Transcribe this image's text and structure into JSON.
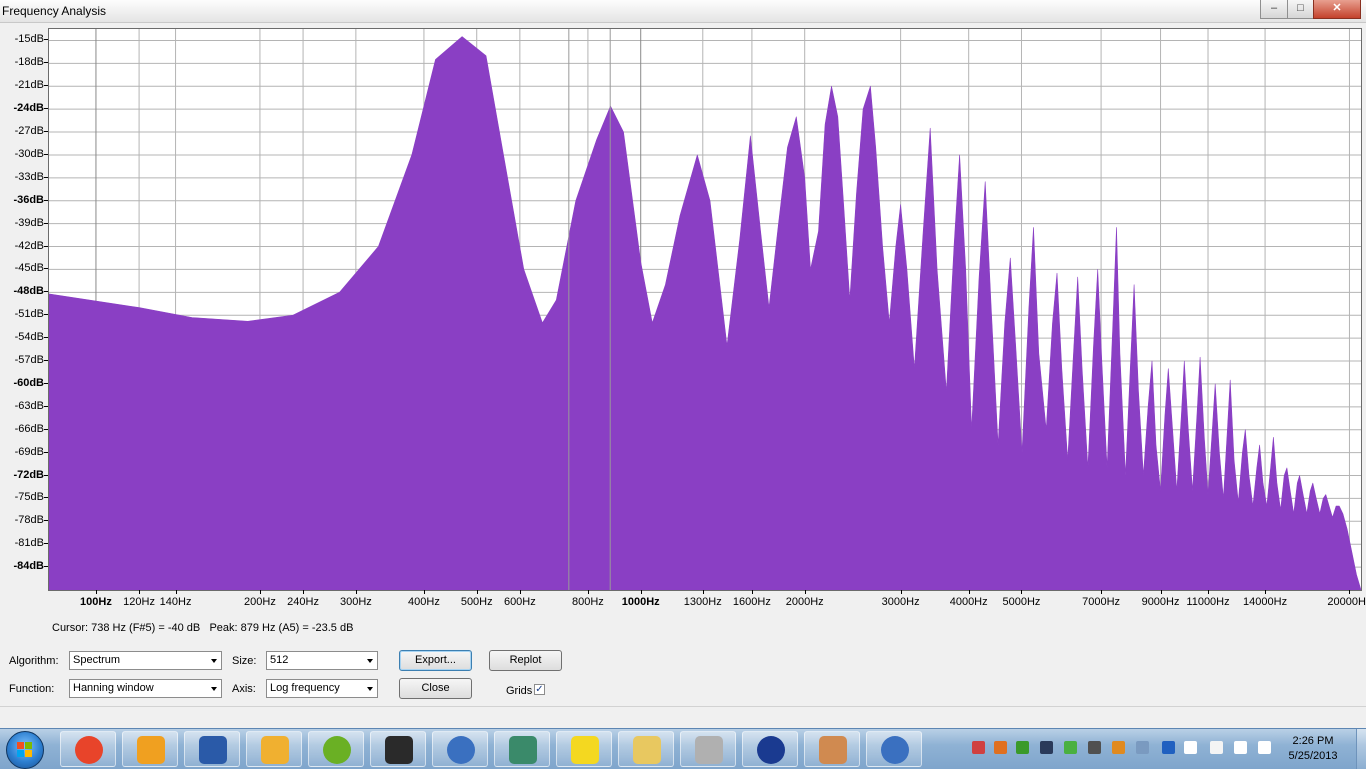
{
  "window": {
    "title": "Frequency Analysis",
    "buttons": {
      "minimize": "–",
      "maximize": "□",
      "close": "✕"
    }
  },
  "chart_data": {
    "type": "area",
    "title": "",
    "xlabel": "",
    "ylabel": "",
    "x_scale": "log",
    "xlim": [
      82,
      21000
    ],
    "ylim": [
      -87,
      -13.5
    ],
    "grid": true,
    "fill_color": "#8a3fc4",
    "y_ticks": [
      "-15dB",
      "-18dB",
      "-21dB",
      "-24dB",
      "-27dB",
      "-30dB",
      "-33dB",
      "-36dB",
      "-39dB",
      "-42dB",
      "-45dB",
      "-48dB",
      "-51dB",
      "-54dB",
      "-57dB",
      "-60dB",
      "-63dB",
      "-66dB",
      "-69dB",
      "-72dB",
      "-75dB",
      "-78dB",
      "-81dB",
      "-84dB"
    ],
    "y_tick_values": [
      -15,
      -18,
      -21,
      -24,
      -27,
      -30,
      -33,
      -36,
      -39,
      -42,
      -45,
      -48,
      -51,
      -54,
      -57,
      -60,
      -63,
      -66,
      -69,
      -72,
      -75,
      -78,
      -81,
      -84
    ],
    "y_tick_bold": [
      -24,
      -36,
      -48,
      -60,
      -72,
      -84
    ],
    "x_ticks": [
      "100Hz",
      "120Hz",
      "140Hz",
      "200Hz",
      "240Hz",
      "300Hz",
      "400Hz",
      "500Hz",
      "600Hz",
      "800Hz",
      "1000Hz",
      "1300Hz",
      "1600Hz",
      "2000Hz",
      "3000Hz",
      "4000Hz",
      "5000Hz",
      "7000Hz",
      "9000Hz",
      "11000Hz",
      "14000Hz",
      "20000Hz"
    ],
    "x_tick_values": [
      100,
      120,
      140,
      200,
      240,
      300,
      400,
      500,
      600,
      800,
      1000,
      1300,
      1600,
      2000,
      3000,
      4000,
      5000,
      7000,
      9000,
      11000,
      14000,
      20000
    ],
    "x_tick_bold": [
      100,
      1000
    ],
    "envelope": [
      [
        82,
        -48.2
      ],
      [
        120,
        -50
      ],
      [
        150,
        -51.3
      ],
      [
        190,
        -51.8
      ],
      [
        230,
        -51
      ],
      [
        280,
        -48
      ],
      [
        330,
        -42
      ],
      [
        380,
        -30
      ],
      [
        420,
        -17.5
      ],
      [
        470,
        -14.5
      ],
      [
        520,
        -17
      ],
      [
        560,
        -30
      ],
      [
        610,
        -45
      ],
      [
        660,
        -52
      ],
      [
        700,
        -49
      ],
      [
        760,
        -36
      ],
      [
        830,
        -28
      ],
      [
        880,
        -23.6
      ],
      [
        930,
        -27
      ],
      [
        1000,
        -44
      ],
      [
        1050,
        -52
      ],
      [
        1110,
        -47
      ],
      [
        1180,
        -38
      ],
      [
        1270,
        -30
      ],
      [
        1340,
        -36
      ],
      [
        1440,
        -55
      ],
      [
        1520,
        -41
      ],
      [
        1590,
        -27.5
      ],
      [
        1660,
        -40
      ],
      [
        1720,
        -50
      ],
      [
        1790,
        -39
      ],
      [
        1860,
        -29
      ],
      [
        1930,
        -25
      ],
      [
        2000,
        -33
      ],
      [
        2050,
        -45
      ],
      [
        2120,
        -40
      ],
      [
        2180,
        -26
      ],
      [
        2240,
        -21
      ],
      [
        2300,
        -25
      ],
      [
        2360,
        -37
      ],
      [
        2420,
        -49
      ],
      [
        2490,
        -35
      ],
      [
        2560,
        -24
      ],
      [
        2640,
        -21
      ],
      [
        2700,
        -29
      ],
      [
        2780,
        -42
      ],
      [
        2860,
        -52
      ],
      [
        2940,
        -42
      ],
      [
        3000,
        -36.5
      ],
      [
        3080,
        -45
      ],
      [
        3180,
        -58
      ],
      [
        3300,
        -40
      ],
      [
        3400,
        -26.5
      ],
      [
        3500,
        -45
      ],
      [
        3640,
        -61
      ],
      [
        3760,
        -42
      ],
      [
        3850,
        -30
      ],
      [
        3950,
        -45
      ],
      [
        4050,
        -66
      ],
      [
        4180,
        -46
      ],
      [
        4290,
        -33.5
      ],
      [
        4400,
        -50
      ],
      [
        4530,
        -68
      ],
      [
        4660,
        -52
      ],
      [
        4770,
        -43.5
      ],
      [
        4880,
        -55
      ],
      [
        5010,
        -69
      ],
      [
        5160,
        -50
      ],
      [
        5260,
        -39.5
      ],
      [
        5380,
        -56
      ],
      [
        5550,
        -66
      ],
      [
        5700,
        -52
      ],
      [
        5810,
        -45.5
      ],
      [
        5930,
        -58
      ],
      [
        6080,
        -70
      ],
      [
        6240,
        -55
      ],
      [
        6340,
        -46
      ],
      [
        6460,
        -58
      ],
      [
        6620,
        -71
      ],
      [
        6780,
        -55
      ],
      [
        6900,
        -45
      ],
      [
        7020,
        -57
      ],
      [
        7180,
        -71
      ],
      [
        7360,
        -52
      ],
      [
        7470,
        -39.5
      ],
      [
        7580,
        -56
      ],
      [
        7760,
        -72
      ],
      [
        7930,
        -57
      ],
      [
        8050,
        -47
      ],
      [
        8200,
        -61
      ],
      [
        8370,
        -72
      ],
      [
        8540,
        -63
      ],
      [
        8680,
        -57
      ],
      [
        8830,
        -68
      ],
      [
        9000,
        -74
      ],
      [
        9170,
        -64
      ],
      [
        9300,
        -58
      ],
      [
        9470,
        -66
      ],
      [
        9640,
        -74
      ],
      [
        9830,
        -64
      ],
      [
        9950,
        -57
      ],
      [
        10120,
        -66
      ],
      [
        10300,
        -74
      ],
      [
        10500,
        -64
      ],
      [
        10640,
        -56.5
      ],
      [
        10830,
        -67
      ],
      [
        11000,
        -74.5
      ],
      [
        11200,
        -66
      ],
      [
        11340,
        -60
      ],
      [
        11540,
        -69
      ],
      [
        11740,
        -75
      ],
      [
        11940,
        -66
      ],
      [
        12080,
        -59.5
      ],
      [
        12280,
        -70
      ],
      [
        12500,
        -75.5
      ],
      [
        12720,
        -69
      ],
      [
        12880,
        -66
      ],
      [
        13080,
        -72
      ],
      [
        13300,
        -76
      ],
      [
        13520,
        -71
      ],
      [
        13680,
        -68
      ],
      [
        13880,
        -73
      ],
      [
        14100,
        -76
      ],
      [
        14330,
        -71
      ],
      [
        14500,
        -67
      ],
      [
        14720,
        -73
      ],
      [
        14950,
        -76.5
      ],
      [
        15180,
        -72
      ],
      [
        15350,
        -71
      ],
      [
        15570,
        -74
      ],
      [
        15800,
        -77
      ],
      [
        16040,
        -73
      ],
      [
        16200,
        -72
      ],
      [
        16440,
        -74.5
      ],
      [
        16700,
        -77
      ],
      [
        16950,
        -74
      ],
      [
        17130,
        -73
      ],
      [
        17380,
        -75
      ],
      [
        17640,
        -77
      ],
      [
        17900,
        -75
      ],
      [
        18100,
        -74.5
      ],
      [
        18350,
        -76
      ],
      [
        18620,
        -77.5
      ],
      [
        18900,
        -76
      ],
      [
        19150,
        -76
      ],
      [
        19450,
        -77
      ],
      [
        19800,
        -79
      ],
      [
        20200,
        -82
      ],
      [
        20600,
        -85
      ],
      [
        21000,
        -87
      ]
    ],
    "cursor_hz": 738,
    "peak_hz": 879
  },
  "status": {
    "cursor": "Cursor: 738 Hz (F#5) = -40 dB",
    "peak": "Peak: 879 Hz (A5) = -23.5 dB"
  },
  "controls": {
    "algorithm_label": "Algorithm:",
    "algorithm_value": "Spectrum",
    "size_label": "Size:",
    "size_value": "512",
    "export_label": "Export...",
    "replot_label": "Replot",
    "function_label": "Function:",
    "function_value": "Hanning window",
    "axis_label": "Axis:",
    "axis_value": "Log frequency",
    "close_label": "Close",
    "grids_label": "Grids",
    "grids_checked": true
  },
  "taskbar": {
    "apps": [
      "chrome-icon",
      "media-player-icon",
      "word-icon",
      "outlook-icon",
      "spotify-icon",
      "steam-icon",
      "firefox-nightly-icon",
      "reaper-icon",
      "zotero-icon",
      "file-explorer-icon",
      "speaker-app-icon",
      "audacity-icon",
      "paint-icon",
      "firefox-nightly-64-icon"
    ],
    "clock_time": "2:26 PM",
    "clock_date": "5/25/2013"
  }
}
